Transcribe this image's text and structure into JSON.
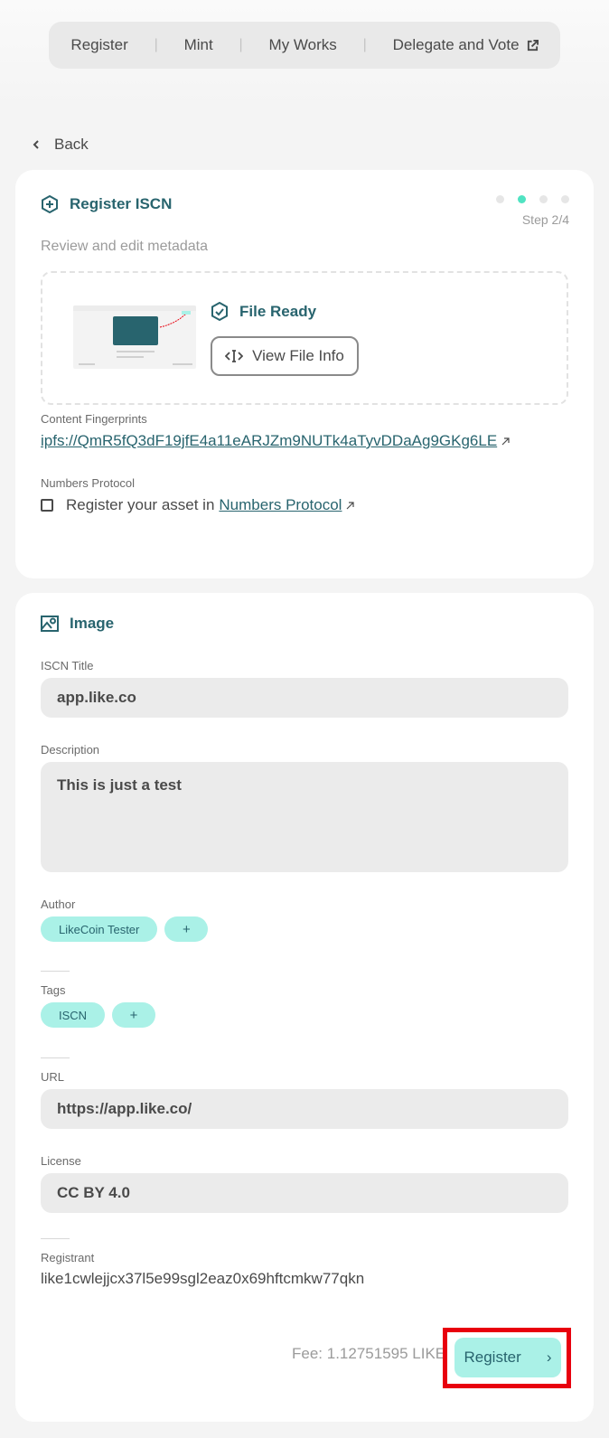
{
  "nav": {
    "items": [
      "Register",
      "Mint",
      "My Works",
      "Delegate and Vote"
    ],
    "separator": "|"
  },
  "back_label": "Back",
  "register_card": {
    "title": "Register ISCN",
    "step_label": "Step 2/4",
    "step_current": 2,
    "step_total": 4,
    "subtitle": "Review and edit metadata",
    "file_status": "File Ready",
    "view_file_button": "View File Info",
    "fingerprints_label": "Content Fingerprints",
    "fingerprint": "ipfs://QmR5fQ3dF19jfE4a11eARJZm9NUTk4aTyvDDaAg9GKg6LE",
    "numbers_protocol_label": "Numbers Protocol",
    "numbers_protocol_text": "Register your asset in",
    "numbers_protocol_link": "Numbers Protocol",
    "numbers_protocol_checked": false
  },
  "image_card": {
    "title": "Image",
    "iscn_title_label": "ISCN Title",
    "iscn_title_value": "app.like.co",
    "description_label": "Description",
    "description_value": "This is just a test",
    "author_label": "Author",
    "authors": [
      "LikeCoin Tester"
    ],
    "add_symbol": "+",
    "tags_label": "Tags",
    "tags": [
      "ISCN"
    ],
    "url_label": "URL",
    "url_value": "https://app.like.co/",
    "license_label": "License",
    "license_value": "CC BY 4.0",
    "registrant_label": "Registrant",
    "registrant_value": "like1cwlejjcx37l5e99sgl2eaz0x69hftcmkw77qkn",
    "fee": "Fee: 1.12751595 LIKE",
    "register_button": "Register",
    "register_arrow": "›"
  },
  "colors": {
    "accent_dark": "#28646e",
    "accent_light": "#aaf1e7",
    "step_active": "#50e3c2",
    "highlight": "#e8000e"
  }
}
